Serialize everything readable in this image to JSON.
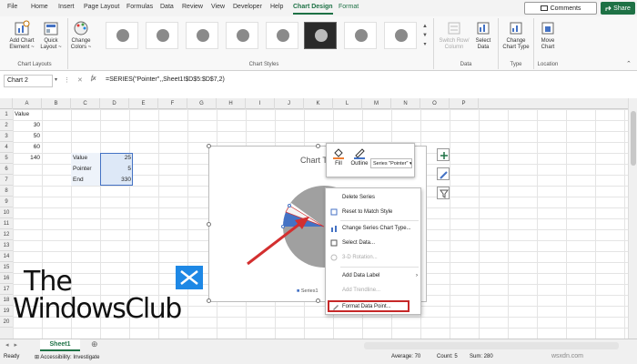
{
  "ribbon_tabs": [
    "File",
    "Home",
    "Insert",
    "Page Layout",
    "Formulas",
    "Data",
    "Review",
    "View",
    "Developer",
    "Help",
    "Chart Design",
    "Format"
  ],
  "comments_label": "Comments",
  "share_label": "Share",
  "ribbon": {
    "add_chart_element": [
      "Add Chart",
      "Element ~"
    ],
    "quick_layout": [
      "Quick",
      "Layout ~"
    ],
    "change_colors": [
      "Change",
      "Colors ~"
    ],
    "chart_layouts_label": "Chart Layouts",
    "chart_styles_label": "Chart Styles",
    "switch_row_column": [
      "Switch Row/",
      "Column"
    ],
    "select_data": [
      "Select",
      "Data"
    ],
    "data_label": "Data",
    "change_chart_type": [
      "Change",
      "Chart Type"
    ],
    "type_label": "Type",
    "move_chart": [
      "Move",
      "Chart"
    ],
    "location_label": "Location"
  },
  "name_box": "Chart 2",
  "formula": "=SERIES(\"Pointer\",,Sheet1!$D$5:$D$7,2)",
  "fx": "fx",
  "columns": [
    "A",
    "B",
    "C",
    "D",
    "E",
    "F",
    "G",
    "H",
    "I",
    "J",
    "K",
    "L",
    "M",
    "N",
    "O",
    "P"
  ],
  "rows": [
    "1",
    "2",
    "3",
    "4",
    "5",
    "6",
    "7",
    "8",
    "9",
    "10",
    "11",
    "12",
    "13",
    "14",
    "15",
    "16",
    "17",
    "18",
    "19",
    "20"
  ],
  "cells": {
    "a1": "Value",
    "a2": "30",
    "a3": "50",
    "a4": "60",
    "a5": "140",
    "c5": "Value",
    "c6": "Pointer",
    "c7": "End",
    "d5": "25",
    "d6": "5",
    "d7": "330"
  },
  "chart": {
    "title": "Chart T",
    "legend": "Series1",
    "floatie_fill": "Fill",
    "floatie_outline": "Outline",
    "series_select": "Series \"Pointer\""
  },
  "context_menu": [
    "Delete Series",
    "Reset to Match Style",
    "Change Series Chart Type...",
    "Select Data...",
    "3-D Rotation...",
    "Add Data Label",
    "Add Trendline...",
    "Format Data Point..."
  ],
  "sheet_tab": "Sheet1",
  "status": {
    "ready": "Ready",
    "accessibility": "Accessibility: Investigate",
    "average": "Average: 70",
    "count": "Count: 5",
    "sum": "Sum: 280"
  },
  "logo": {
    "line1": "The",
    "line2": "WindowsClub"
  },
  "watermark": "wsxdn.com",
  "colors": {
    "accent": "#1e7145",
    "pie_grey": "#a0a0a0",
    "pointer_blue": "#4472c4",
    "arrow_red": "#d32f2f",
    "highlight_red": "#c62828"
  }
}
